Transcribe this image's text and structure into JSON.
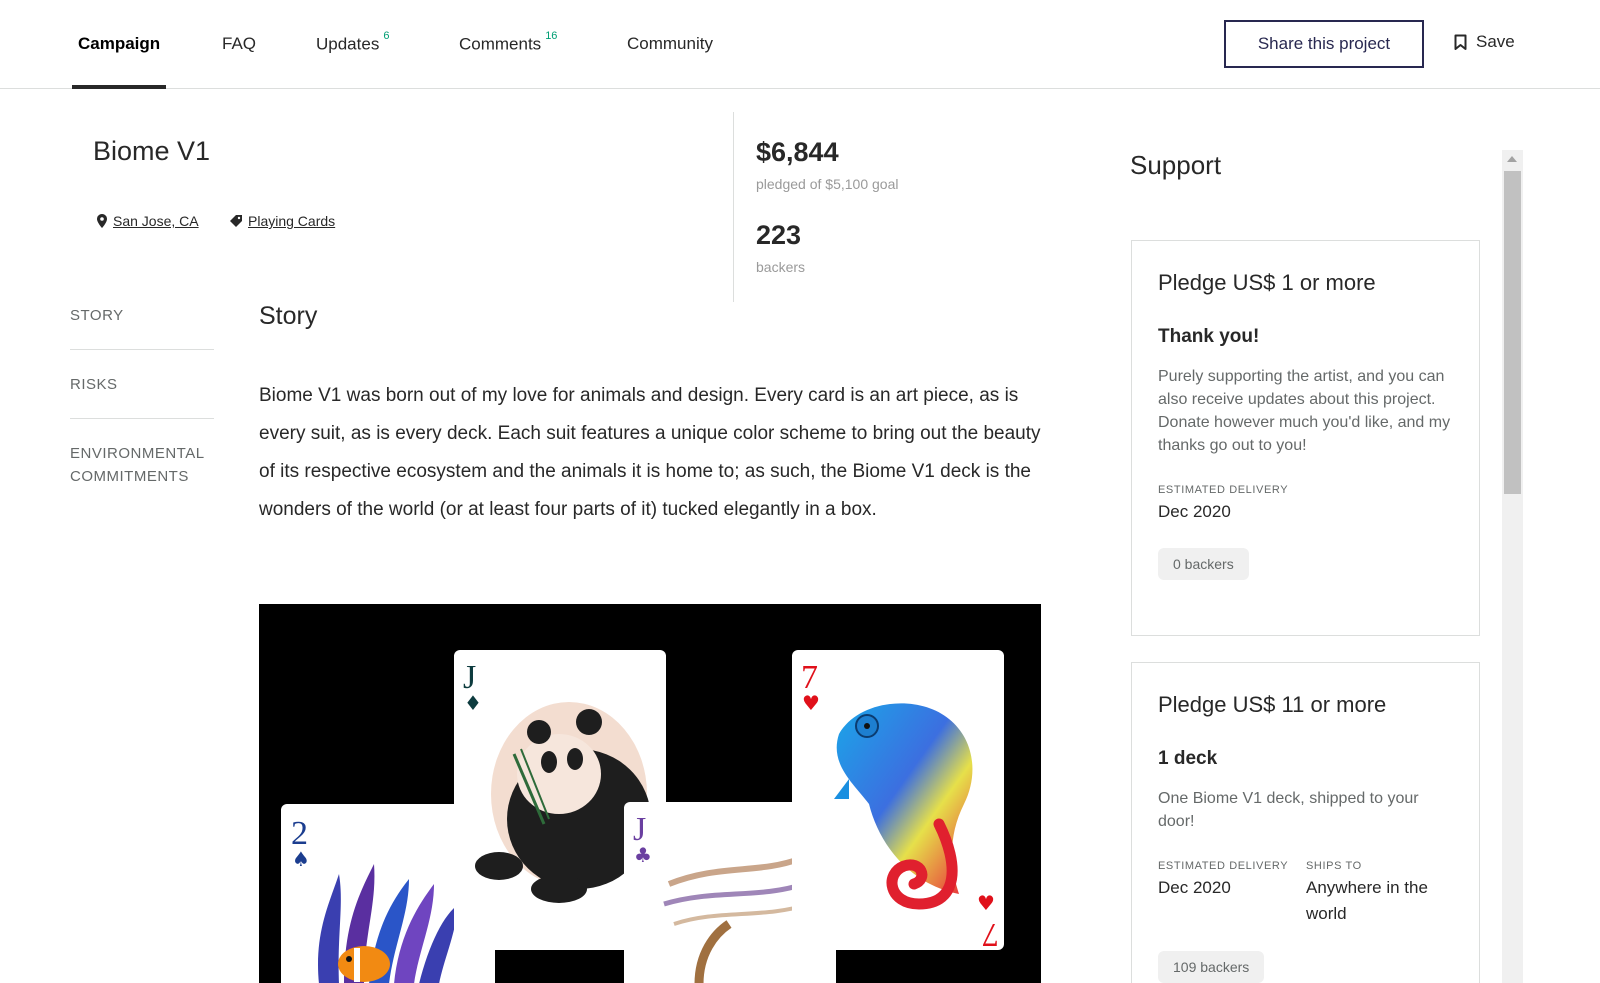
{
  "tabs": [
    {
      "label": "Campaign",
      "count": ""
    },
    {
      "label": "FAQ",
      "count": ""
    },
    {
      "label": "Updates",
      "count": "6"
    },
    {
      "label": "Comments",
      "count": "16"
    },
    {
      "label": "Community",
      "count": ""
    }
  ],
  "actions": {
    "share_label": "Share this project",
    "save_label": "Save"
  },
  "project": {
    "title": "Biome V1",
    "location": "San Jose, CA",
    "category": "Playing Cards"
  },
  "stats": {
    "pledged": "$6,844",
    "pledged_caption": "pledged of $5,100 goal",
    "backers": "223",
    "backers_caption": "backers"
  },
  "sidenav": [
    "STORY",
    "RISKS",
    "ENVIRONMENTAL COMMITMENTS"
  ],
  "story": {
    "heading": "Story",
    "body": "Biome V1 was born out of my love for animals and design. Every card is an art piece, as is every suit, as is every deck. Each suit features a unique color scheme to bring out the beauty of its respective ecosystem and the animals it is home to; as such, the Biome V1 deck is the wonders of the world (or at least four parts of it) tucked elegantly in a box.",
    "image_cards": [
      {
        "rank": "2",
        "suit": "♠",
        "suit_color": "#1b3d8f"
      },
      {
        "rank": "J",
        "suit": "♦",
        "suit_color": "#0d3b3e"
      },
      {
        "rank": "J",
        "suit": "♣",
        "suit_color": "#6a3fa0"
      },
      {
        "rank": "7",
        "suit": "♥",
        "suit_color": "#e0101a"
      }
    ]
  },
  "support": {
    "heading": "Support",
    "pledges": [
      {
        "title": "Pledge US$ 1 or more",
        "reward": "Thank you!",
        "description": "Purely supporting the artist, and you can also receive updates about this project. Donate however much you'd like, and my thanks go out to you!",
        "delivery_label": "ESTIMATED DELIVERY",
        "delivery": "Dec 2020",
        "ships_label": "",
        "ships": "",
        "backers": "0 backers"
      },
      {
        "title": "Pledge US$ 11 or more",
        "reward": "1 deck",
        "description": "One Biome V1 deck, shipped to your door!",
        "delivery_label": "ESTIMATED DELIVERY",
        "delivery": "Dec 2020",
        "ships_label": "SHIPS TO",
        "ships": "Anywhere in the world",
        "backers": "109 backers"
      }
    ]
  },
  "colors": {
    "accent_green": "#009e74",
    "share_border": "#282850"
  }
}
